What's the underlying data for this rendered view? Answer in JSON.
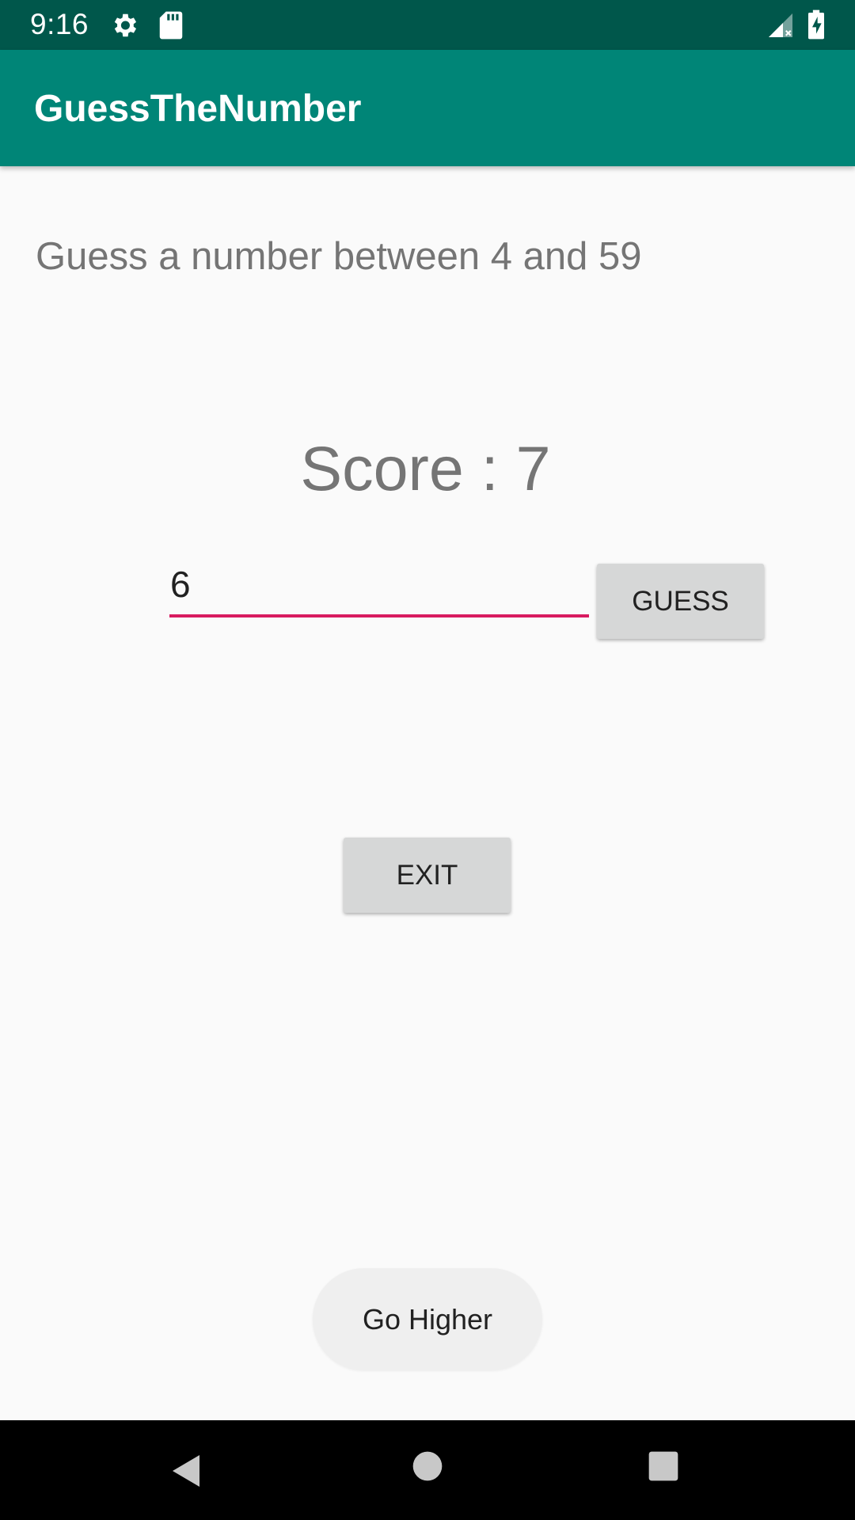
{
  "status_bar": {
    "time": "9:16",
    "icons": [
      "gear-icon",
      "sd-card-icon",
      "signal-icon",
      "battery-charging-icon"
    ]
  },
  "app_bar": {
    "title": "GuessTheNumber",
    "color": "#008577",
    "status_color": "#00574b"
  },
  "main": {
    "range_text": "Guess a number between 4 and 59",
    "score_text": "Score : 7",
    "guess_input": {
      "value": "6",
      "placeholder": ""
    },
    "guess_button_label": "GUESS",
    "exit_button_label": "EXIT",
    "accent_color": "#d81b60"
  },
  "toast": {
    "message": "Go Higher"
  },
  "nav_bar": {
    "buttons": [
      "back-icon",
      "home-icon",
      "recents-icon"
    ]
  }
}
